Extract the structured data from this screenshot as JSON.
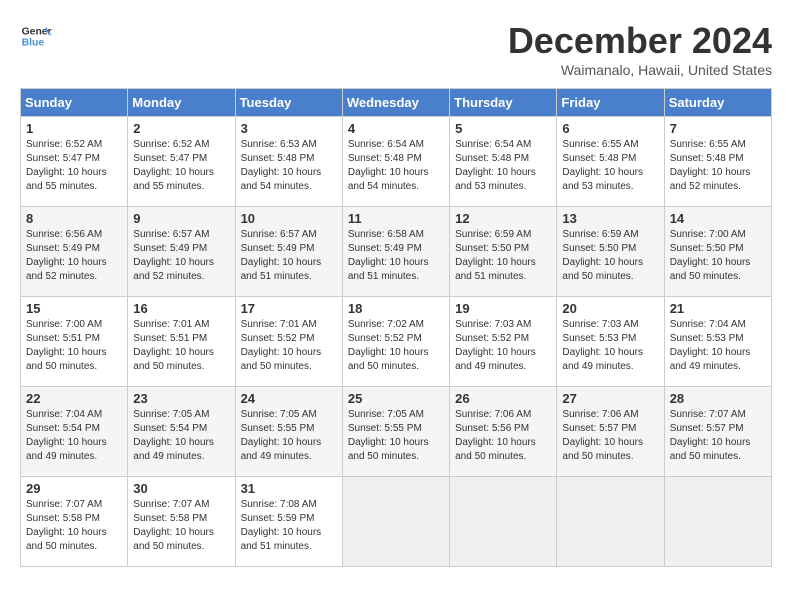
{
  "logo": {
    "line1": "General",
    "line2": "Blue"
  },
  "title": "December 2024",
  "location": "Waimanalo, Hawaii, United States",
  "days_of_week": [
    "Sunday",
    "Monday",
    "Tuesday",
    "Wednesday",
    "Thursday",
    "Friday",
    "Saturday"
  ],
  "weeks": [
    [
      {
        "day": "1",
        "info": "Sunrise: 6:52 AM\nSunset: 5:47 PM\nDaylight: 10 hours\nand 55 minutes."
      },
      {
        "day": "2",
        "info": "Sunrise: 6:52 AM\nSunset: 5:47 PM\nDaylight: 10 hours\nand 55 minutes."
      },
      {
        "day": "3",
        "info": "Sunrise: 6:53 AM\nSunset: 5:48 PM\nDaylight: 10 hours\nand 54 minutes."
      },
      {
        "day": "4",
        "info": "Sunrise: 6:54 AM\nSunset: 5:48 PM\nDaylight: 10 hours\nand 54 minutes."
      },
      {
        "day": "5",
        "info": "Sunrise: 6:54 AM\nSunset: 5:48 PM\nDaylight: 10 hours\nand 53 minutes."
      },
      {
        "day": "6",
        "info": "Sunrise: 6:55 AM\nSunset: 5:48 PM\nDaylight: 10 hours\nand 53 minutes."
      },
      {
        "day": "7",
        "info": "Sunrise: 6:55 AM\nSunset: 5:48 PM\nDaylight: 10 hours\nand 52 minutes."
      }
    ],
    [
      {
        "day": "8",
        "info": "Sunrise: 6:56 AM\nSunset: 5:49 PM\nDaylight: 10 hours\nand 52 minutes."
      },
      {
        "day": "9",
        "info": "Sunrise: 6:57 AM\nSunset: 5:49 PM\nDaylight: 10 hours\nand 52 minutes."
      },
      {
        "day": "10",
        "info": "Sunrise: 6:57 AM\nSunset: 5:49 PM\nDaylight: 10 hours\nand 51 minutes."
      },
      {
        "day": "11",
        "info": "Sunrise: 6:58 AM\nSunset: 5:49 PM\nDaylight: 10 hours\nand 51 minutes."
      },
      {
        "day": "12",
        "info": "Sunrise: 6:59 AM\nSunset: 5:50 PM\nDaylight: 10 hours\nand 51 minutes."
      },
      {
        "day": "13",
        "info": "Sunrise: 6:59 AM\nSunset: 5:50 PM\nDaylight: 10 hours\nand 50 minutes."
      },
      {
        "day": "14",
        "info": "Sunrise: 7:00 AM\nSunset: 5:50 PM\nDaylight: 10 hours\nand 50 minutes."
      }
    ],
    [
      {
        "day": "15",
        "info": "Sunrise: 7:00 AM\nSunset: 5:51 PM\nDaylight: 10 hours\nand 50 minutes."
      },
      {
        "day": "16",
        "info": "Sunrise: 7:01 AM\nSunset: 5:51 PM\nDaylight: 10 hours\nand 50 minutes."
      },
      {
        "day": "17",
        "info": "Sunrise: 7:01 AM\nSunset: 5:52 PM\nDaylight: 10 hours\nand 50 minutes."
      },
      {
        "day": "18",
        "info": "Sunrise: 7:02 AM\nSunset: 5:52 PM\nDaylight: 10 hours\nand 50 minutes."
      },
      {
        "day": "19",
        "info": "Sunrise: 7:03 AM\nSunset: 5:52 PM\nDaylight: 10 hours\nand 49 minutes."
      },
      {
        "day": "20",
        "info": "Sunrise: 7:03 AM\nSunset: 5:53 PM\nDaylight: 10 hours\nand 49 minutes."
      },
      {
        "day": "21",
        "info": "Sunrise: 7:04 AM\nSunset: 5:53 PM\nDaylight: 10 hours\nand 49 minutes."
      }
    ],
    [
      {
        "day": "22",
        "info": "Sunrise: 7:04 AM\nSunset: 5:54 PM\nDaylight: 10 hours\nand 49 minutes."
      },
      {
        "day": "23",
        "info": "Sunrise: 7:05 AM\nSunset: 5:54 PM\nDaylight: 10 hours\nand 49 minutes."
      },
      {
        "day": "24",
        "info": "Sunrise: 7:05 AM\nSunset: 5:55 PM\nDaylight: 10 hours\nand 49 minutes."
      },
      {
        "day": "25",
        "info": "Sunrise: 7:05 AM\nSunset: 5:55 PM\nDaylight: 10 hours\nand 50 minutes."
      },
      {
        "day": "26",
        "info": "Sunrise: 7:06 AM\nSunset: 5:56 PM\nDaylight: 10 hours\nand 50 minutes."
      },
      {
        "day": "27",
        "info": "Sunrise: 7:06 AM\nSunset: 5:57 PM\nDaylight: 10 hours\nand 50 minutes."
      },
      {
        "day": "28",
        "info": "Sunrise: 7:07 AM\nSunset: 5:57 PM\nDaylight: 10 hours\nand 50 minutes."
      }
    ],
    [
      {
        "day": "29",
        "info": "Sunrise: 7:07 AM\nSunset: 5:58 PM\nDaylight: 10 hours\nand 50 minutes."
      },
      {
        "day": "30",
        "info": "Sunrise: 7:07 AM\nSunset: 5:58 PM\nDaylight: 10 hours\nand 50 minutes."
      },
      {
        "day": "31",
        "info": "Sunrise: 7:08 AM\nSunset: 5:59 PM\nDaylight: 10 hours\nand 51 minutes."
      },
      {
        "day": "",
        "info": ""
      },
      {
        "day": "",
        "info": ""
      },
      {
        "day": "",
        "info": ""
      },
      {
        "day": "",
        "info": ""
      }
    ]
  ]
}
